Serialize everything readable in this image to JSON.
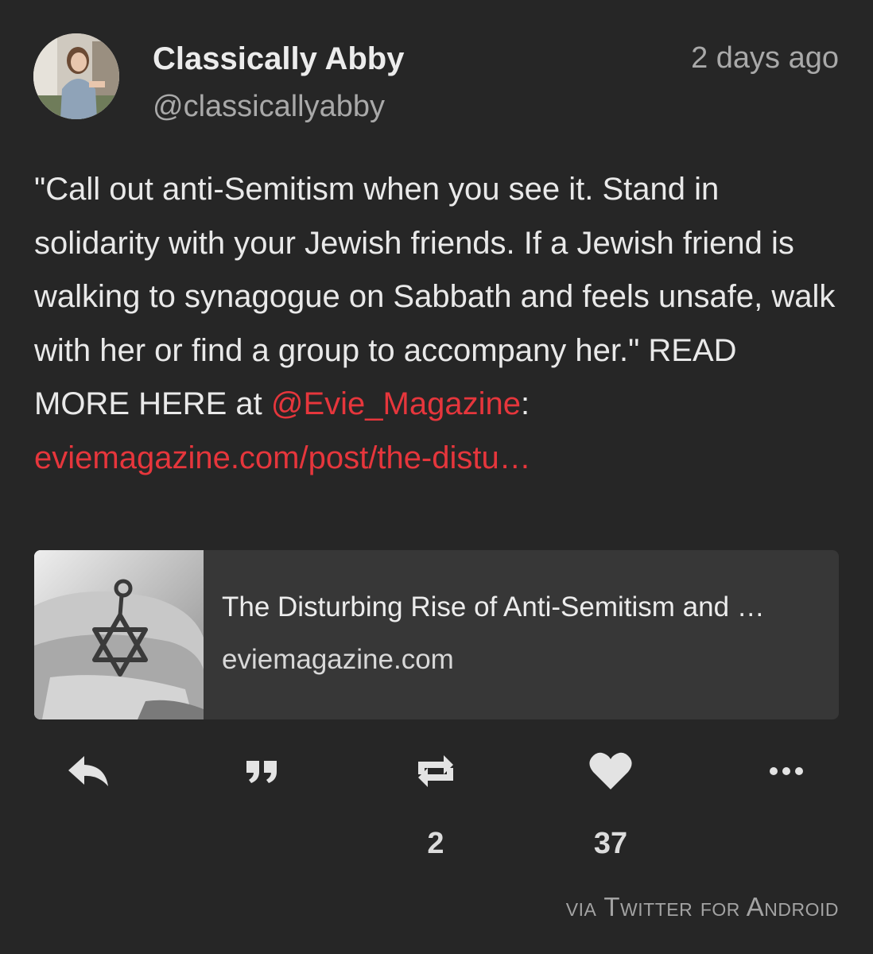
{
  "post": {
    "author": {
      "name": "Classically Abby",
      "handle": "@classicallyabby"
    },
    "timestamp": "2 days ago",
    "text": {
      "part1": "\"Call out anti-Semitism when you see it. Stand in solidarity with your Jewish friends. If a Jewish friend is walking to synagogue on Sabbath and feels unsafe, walk with her or find a group to accompany her.\" READ MORE HERE at ",
      "mention": "@Evie_Magazine",
      "part2": ": ",
      "url": "eviemagazine.com/post/the-distu…"
    },
    "link_card": {
      "title": "The Disturbing Rise of Anti-Semitism and …",
      "domain": "eviemagazine.com"
    },
    "actions": {
      "reply_icon": "reply-icon",
      "quote_icon": "quote-icon",
      "retweet_icon": "retweet-icon",
      "like_icon": "heart-icon",
      "more_icon": "more-icon",
      "retweet_count": "2",
      "like_count": "37"
    },
    "source": "via Twitter for Android"
  },
  "colors": {
    "background": "#262626",
    "link": "#e6363c",
    "card": "#373737",
    "muted": "#a9a9a9"
  }
}
